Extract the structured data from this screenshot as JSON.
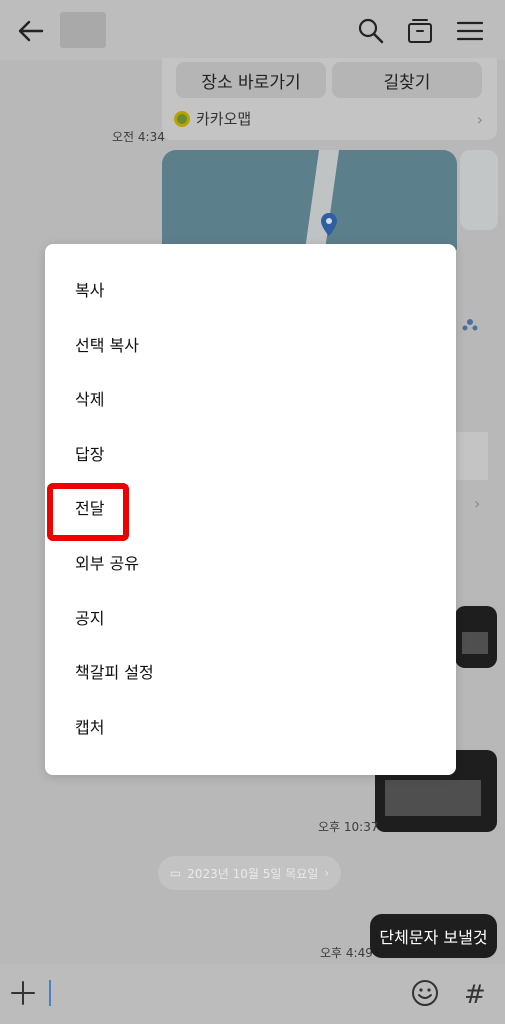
{
  "place_card": {
    "goto_label": "장소 바로가기",
    "directions_label": "길찾기",
    "source_label": "카카오맵"
  },
  "chat": {
    "time_1": "오전 4:34",
    "time_2": "오후 10:37",
    "date_divider": "2023년 10월 5일 목요일",
    "time_3": "오후 4:49",
    "last_message": "단체문자 보낼것"
  },
  "context_menu": {
    "items": [
      "복사",
      "선택 복사",
      "삭제",
      "답장",
      "전달",
      "외부 공유",
      "공지",
      "책갈피 설정",
      "캡처"
    ],
    "highlighted": "전달"
  },
  "icons": {
    "back": "back-arrow-icon",
    "search": "search-icon",
    "drawer": "drawer-icon",
    "menu": "hamburger-menu-icon",
    "plus": "plus-icon",
    "emoji": "emoji-icon",
    "hash": "hash-icon"
  },
  "colors": {
    "highlight": "#ee0000",
    "caret": "#4a7fc8"
  }
}
